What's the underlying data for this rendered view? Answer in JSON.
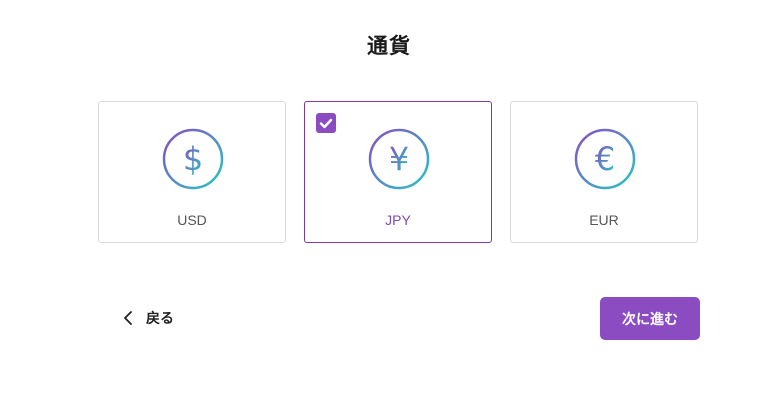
{
  "page": {
    "title": "通貨"
  },
  "currency_options": [
    {
      "code": "USD",
      "symbol": "$",
      "icon": "dollar-icon",
      "selected": false
    },
    {
      "code": "JPY",
      "symbol": "¥",
      "icon": "yen-icon",
      "selected": true
    },
    {
      "code": "EUR",
      "symbol": "€",
      "icon": "euro-icon",
      "selected": false
    }
  ],
  "footer": {
    "back_label": "戻る",
    "next_label": "次に進む"
  },
  "colors": {
    "accent": "#8a4cc0",
    "selected_border": "#7d3c98",
    "icon_gradient_start": "#8a4cc0",
    "icon_gradient_end": "#25c6c6",
    "card_border": "#d9d9d9"
  }
}
